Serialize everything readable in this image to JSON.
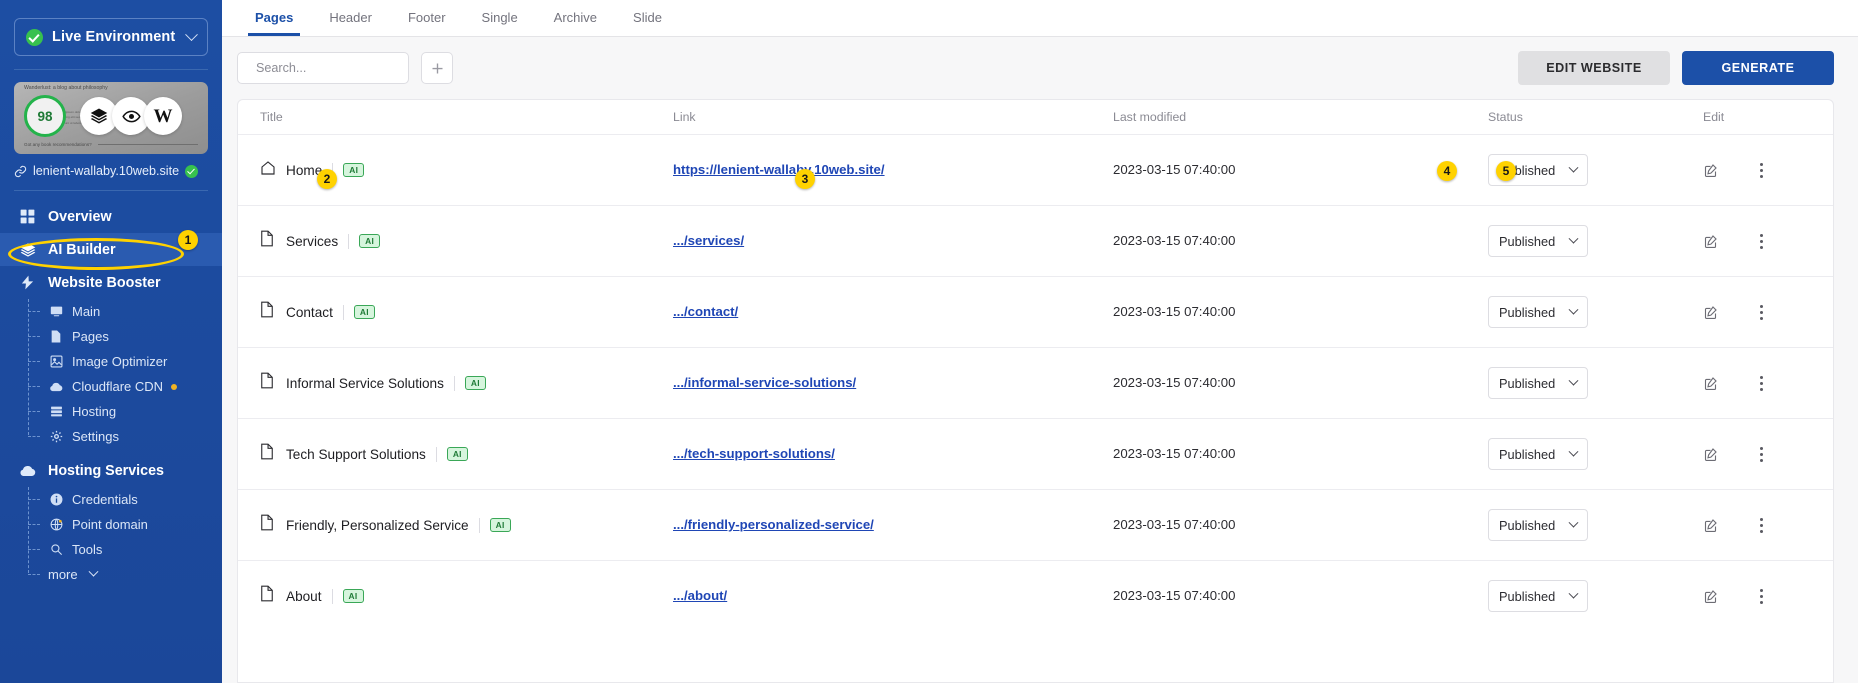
{
  "sidebar": {
    "environment": {
      "label": "Live Environment",
      "status_icon": "green-check-icon",
      "caret_icon": "chevron-down-icon"
    },
    "site_card": {
      "score": "98",
      "thumb_heading": "Wanderlust: a blog about philosophy",
      "thumb_body": "Lorem ipsum dolor sit amet consectetur adipiscing elit sed do eiusmod tempor incididunt ut labore",
      "thumb_footer": "Got any book recommendations?",
      "actions": [
        {
          "name": "layers-icon",
          "glyph": "layers"
        },
        {
          "name": "eye-icon",
          "glyph": "eye"
        },
        {
          "name": "wordpress-icon",
          "glyph": "W"
        }
      ]
    },
    "site_url": {
      "label": "lenient-wallaby.10web.site",
      "link_icon": "link-icon",
      "status_icon": "green-check-icon"
    },
    "nav": [
      {
        "label": "Overview",
        "icon": "grid-icon",
        "active": false
      },
      {
        "label": "AI Builder",
        "icon": "layers-icon",
        "active": true
      },
      {
        "label": "Website Booster",
        "icon": "bolt-icon",
        "active": false
      }
    ],
    "booster_sub": [
      {
        "label": "Main",
        "icon": "monitor-icon",
        "dot": false
      },
      {
        "label": "Pages",
        "icon": "page-icon",
        "dot": false
      },
      {
        "label": "Image Optimizer",
        "icon": "image-icon",
        "dot": false
      },
      {
        "label": "Cloudflare CDN",
        "icon": "cloud-icon",
        "dot": true
      },
      {
        "label": "Hosting",
        "icon": "server-icon",
        "dot": false
      },
      {
        "label": "Settings",
        "icon": "gear-icon",
        "dot": false
      }
    ],
    "hosting_services": {
      "label": "Hosting Services",
      "icon": "cloud-icon"
    },
    "hosting_sub": [
      {
        "label": "Credentials",
        "icon": "info-icon",
        "dot": false
      },
      {
        "label": "Point domain",
        "icon": "globe-icon",
        "dot": false
      },
      {
        "label": "Tools",
        "icon": "tools-icon",
        "dot": false
      }
    ],
    "more": {
      "label": "more",
      "icon": "chevron-down-icon"
    }
  },
  "annotations": [
    {
      "number": "1",
      "target": "sidebar-item-ai-builder"
    },
    {
      "number": "2",
      "target": "row-home-ai-chip"
    },
    {
      "number": "3",
      "target": "row-home-link"
    },
    {
      "number": "4",
      "target": "row-home-status-select"
    },
    {
      "number": "5",
      "target": "row-home-edit-button"
    }
  ],
  "main": {
    "tabs": [
      {
        "label": "Pages",
        "active": true
      },
      {
        "label": "Header",
        "active": false
      },
      {
        "label": "Footer",
        "active": false
      },
      {
        "label": "Single",
        "active": false
      },
      {
        "label": "Archive",
        "active": false
      },
      {
        "label": "Slide",
        "active": false
      }
    ],
    "search": {
      "placeholder": "Search...",
      "value": "",
      "icon": "search-icon"
    },
    "add_button": {
      "icon": "plus-icon"
    },
    "edit_website_label": "EDIT WEBSITE",
    "generate_label": "GENERATE",
    "table": {
      "columns": [
        "Title",
        "Link",
        "Last modified",
        "Status",
        "Edit"
      ],
      "status_caret_icon": "chevron-down-icon",
      "edit_icon": "pencil-square-icon",
      "more_icon": "kebab-menu-icon",
      "rows": [
        {
          "icon": "home-icon",
          "title": "Home",
          "chip": "AI",
          "link": "https://lenient-wallaby.10web.site/",
          "modified": "2023-03-15 07:40:00",
          "status": "Published"
        },
        {
          "icon": "document-icon",
          "title": "Services",
          "chip": "AI",
          "link": ".../services/",
          "modified": "2023-03-15 07:40:00",
          "status": "Published"
        },
        {
          "icon": "document-icon",
          "title": "Contact",
          "chip": "AI",
          "link": ".../contact/",
          "modified": "2023-03-15 07:40:00",
          "status": "Published"
        },
        {
          "icon": "document-icon",
          "title": "Informal Service Solutions",
          "chip": "AI",
          "link": ".../informal-service-solutions/",
          "modified": "2023-03-15 07:40:00",
          "status": "Published"
        },
        {
          "icon": "document-icon",
          "title": "Tech Support Solutions",
          "chip": "AI",
          "link": ".../tech-support-solutions/",
          "modified": "2023-03-15 07:40:00",
          "status": "Published"
        },
        {
          "icon": "document-icon",
          "title": "Friendly, Personalized Service",
          "chip": "AI",
          "link": ".../friendly-personalized-service/",
          "modified": "2023-03-15 07:40:00",
          "status": "Published"
        },
        {
          "icon": "document-icon",
          "title": "About",
          "chip": "AI",
          "link": ".../about/",
          "modified": "2023-03-15 07:40:00",
          "status": "Published"
        }
      ]
    }
  },
  "colors": {
    "sidebar_bg": "#1b4b9c",
    "accent_blue": "#1c50a8",
    "link_blue": "#1f46b5",
    "highlight_yellow": "#ffd200",
    "chip_green": "#3aa757",
    "status_green": "#37c14e"
  }
}
